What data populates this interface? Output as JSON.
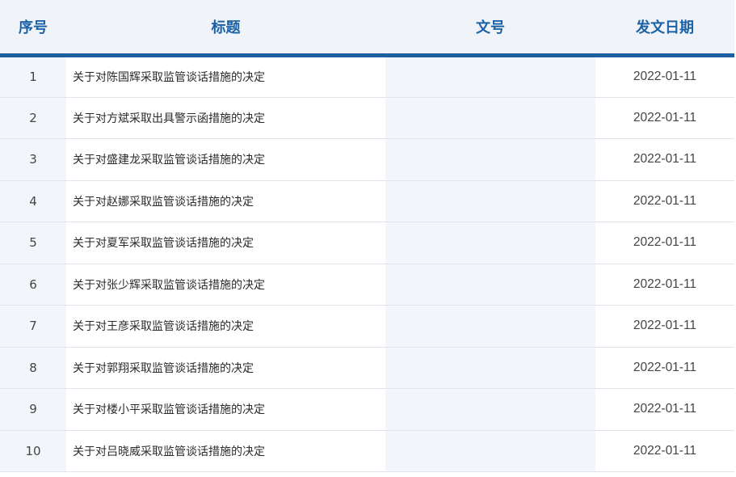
{
  "table": {
    "headers": {
      "index": "序号",
      "title": "标题",
      "doc_number": "文号",
      "date": "发文日期"
    },
    "rows": [
      {
        "index": "1",
        "title": "关于对陈国辉采取监管谈话措施的决定",
        "doc_number": "",
        "date": "2022-01-11"
      },
      {
        "index": "2",
        "title": "关于对方斌采取出具警示函措施的决定",
        "doc_number": "",
        "date": "2022-01-11"
      },
      {
        "index": "3",
        "title": "关于对盛建龙采取监管谈话措施的决定",
        "doc_number": "",
        "date": "2022-01-11"
      },
      {
        "index": "4",
        "title": "关于对赵娜采取监管谈话措施的决定",
        "doc_number": "",
        "date": "2022-01-11"
      },
      {
        "index": "5",
        "title": "关于对夏军采取监管谈话措施的决定",
        "doc_number": "",
        "date": "2022-01-11"
      },
      {
        "index": "6",
        "title": "关于对张少辉采取监管谈话措施的决定",
        "doc_number": "",
        "date": "2022-01-11"
      },
      {
        "index": "7",
        "title": "关于对王彦采取监管谈话措施的决定",
        "doc_number": "",
        "date": "2022-01-11"
      },
      {
        "index": "8",
        "title": "关于对郭翔采取监管谈话措施的决定",
        "doc_number": "",
        "date": "2022-01-11"
      },
      {
        "index": "9",
        "title": "关于对楼小平采取监管谈话措施的决定",
        "doc_number": "",
        "date": "2022-01-11"
      },
      {
        "index": "10",
        "title": "关于对吕晓威采取监管谈话措施的决定",
        "doc_number": "",
        "date": "2022-01-11"
      }
    ]
  },
  "colors": {
    "header_text": "#1d62a6",
    "header_rule": "#1f5fa0",
    "stripe_bg": "#f2f6fa",
    "row_border": "#dfe5ec"
  }
}
